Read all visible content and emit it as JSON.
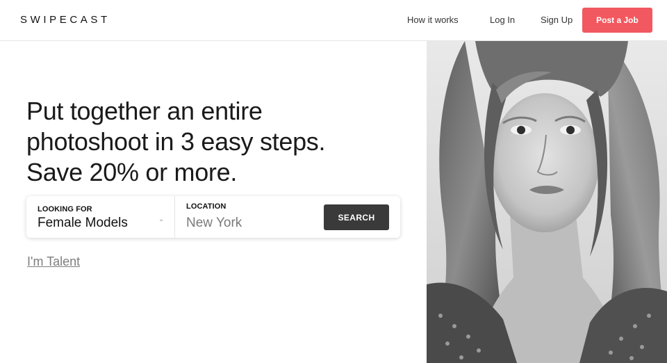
{
  "header": {
    "logo": "SWIPECAST",
    "nav": {
      "how_it_works": "How it works",
      "log_in": "Log In",
      "sign_up": "Sign Up",
      "post_job": "Post a Job"
    }
  },
  "hero": {
    "headline_lines": [
      "Put together an entire",
      "photoshoot in 3 easy steps.",
      "Save 20% or more."
    ]
  },
  "search": {
    "looking_label": "LOOKING FOR",
    "looking_value": "Female Models",
    "location_label": "LOCATION",
    "location_placeholder": "New York",
    "button_label": "SEARCH"
  },
  "talent_link": "I'm Talent",
  "colors": {
    "accent": "#f2585f",
    "search_button": "#3a3a3a"
  }
}
